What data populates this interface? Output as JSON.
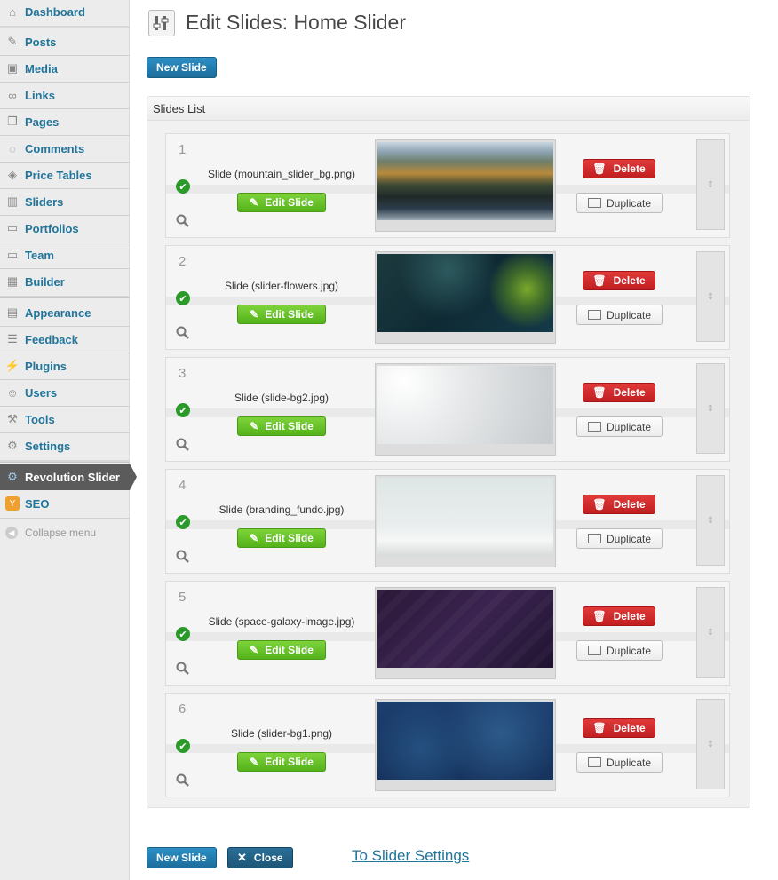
{
  "sidebar": {
    "items": [
      {
        "label": "Dashboard",
        "icon": "home-icon"
      },
      {
        "label": "Posts",
        "icon": "pin-icon"
      },
      {
        "label": "Media",
        "icon": "media-icon"
      },
      {
        "label": "Links",
        "icon": "link-icon"
      },
      {
        "label": "Pages",
        "icon": "pages-icon"
      },
      {
        "label": "Comments",
        "icon": "comment-icon"
      },
      {
        "label": "Price Tables",
        "icon": "tag-icon"
      },
      {
        "label": "Sliders",
        "icon": "slider-icon"
      },
      {
        "label": "Portfolios",
        "icon": "folder-icon"
      },
      {
        "label": "Team",
        "icon": "folder-icon"
      },
      {
        "label": "Builder",
        "icon": "builder-icon"
      },
      {
        "label": "Appearance",
        "icon": "appearance-icon"
      },
      {
        "label": "Feedback",
        "icon": "feedback-icon"
      },
      {
        "label": "Plugins",
        "icon": "plugin-icon"
      },
      {
        "label": "Users",
        "icon": "users-icon"
      },
      {
        "label": "Tools",
        "icon": "tools-icon"
      },
      {
        "label": "Settings",
        "icon": "settings-icon"
      },
      {
        "label": "Revolution Slider",
        "icon": "gear-icon"
      },
      {
        "label": "SEO",
        "icon": "seo-icon"
      }
    ],
    "collapse_label": "Collapse menu"
  },
  "header": {
    "title": "Edit Slides: Home Slider"
  },
  "toolbar": {
    "new_slide_label": "New Slide",
    "close_label": "Close",
    "settings_link": "To Slider Settings"
  },
  "panel": {
    "title": "Slides List"
  },
  "slides": [
    {
      "num": "1",
      "name": "Slide (mountain_slider_bg.png)"
    },
    {
      "num": "2",
      "name": "Slide (slider-flowers.jpg)"
    },
    {
      "num": "3",
      "name": "Slide (slide-bg2.jpg)"
    },
    {
      "num": "4",
      "name": "Slide (branding_fundo.jpg)"
    },
    {
      "num": "5",
      "name": "Slide (space-galaxy-image.jpg)"
    },
    {
      "num": "6",
      "name": "Slide (slider-bg1.png)"
    }
  ],
  "slide_actions": {
    "edit_label": "Edit Slide",
    "delete_label": "Delete",
    "duplicate_label": "Duplicate"
  },
  "colors": {
    "link": "#21759b",
    "edit": "#5cb82a",
    "delete": "#cc2526",
    "primary": "#21759b"
  }
}
